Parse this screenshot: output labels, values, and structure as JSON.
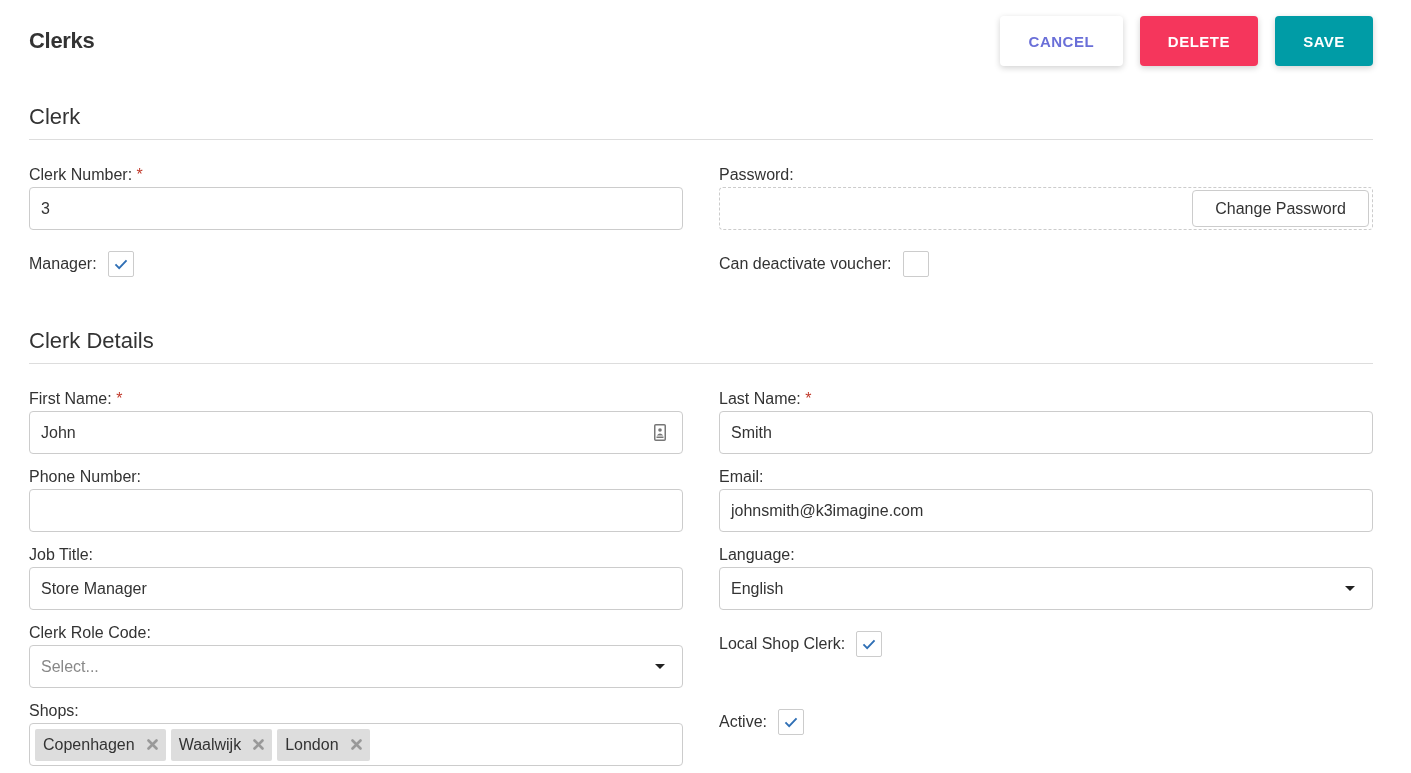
{
  "header": {
    "title": "Clerks",
    "buttons": [
      {
        "label": "CANCEL",
        "kind": "secondary"
      },
      {
        "label": "DELETE",
        "kind": "danger"
      },
      {
        "label": "SAVE",
        "kind": "primary"
      }
    ]
  },
  "sections": [
    {
      "title": "Clerk",
      "fields": [
        {
          "kind": "text",
          "label": "Clerk Number:",
          "required_mark": "*",
          "value": "3"
        },
        {
          "kind": "password",
          "label": "Password:",
          "button": "Change Password"
        },
        {
          "kind": "checkbox",
          "label": "Manager:",
          "checked": true
        },
        {
          "kind": "checkbox",
          "label": "Can deactivate voucher:",
          "checked": false
        }
      ]
    },
    {
      "title": "Clerk Details",
      "fields": [
        {
          "kind": "text",
          "label": "First Name:",
          "required_mark": "*",
          "value": "John",
          "contact_icon": true
        },
        {
          "kind": "text",
          "label": "Last Name:",
          "required_mark": "*",
          "value": "Smith"
        },
        {
          "kind": "text",
          "label": "Phone Number:"
        },
        {
          "kind": "text",
          "label": "Email:",
          "value": "johnsmith@k3imagine.com"
        },
        {
          "kind": "text",
          "label": "Job Title:",
          "value": "Store Manager"
        },
        {
          "kind": "select",
          "label": "Language:",
          "value": "English"
        },
        {
          "kind": "select",
          "label": "Clerk Role Code:",
          "placeholder": "Select..."
        },
        {
          "kind": "checkbox",
          "label": "Local Shop Clerk:",
          "checked": true
        },
        {
          "kind": "tags",
          "label": "Shops:",
          "tags": [
            "Copenhagen",
            "Waalwijk",
            "London"
          ]
        },
        {
          "kind": "checkbox",
          "label": "Active:",
          "checked": true
        }
      ]
    }
  ]
}
